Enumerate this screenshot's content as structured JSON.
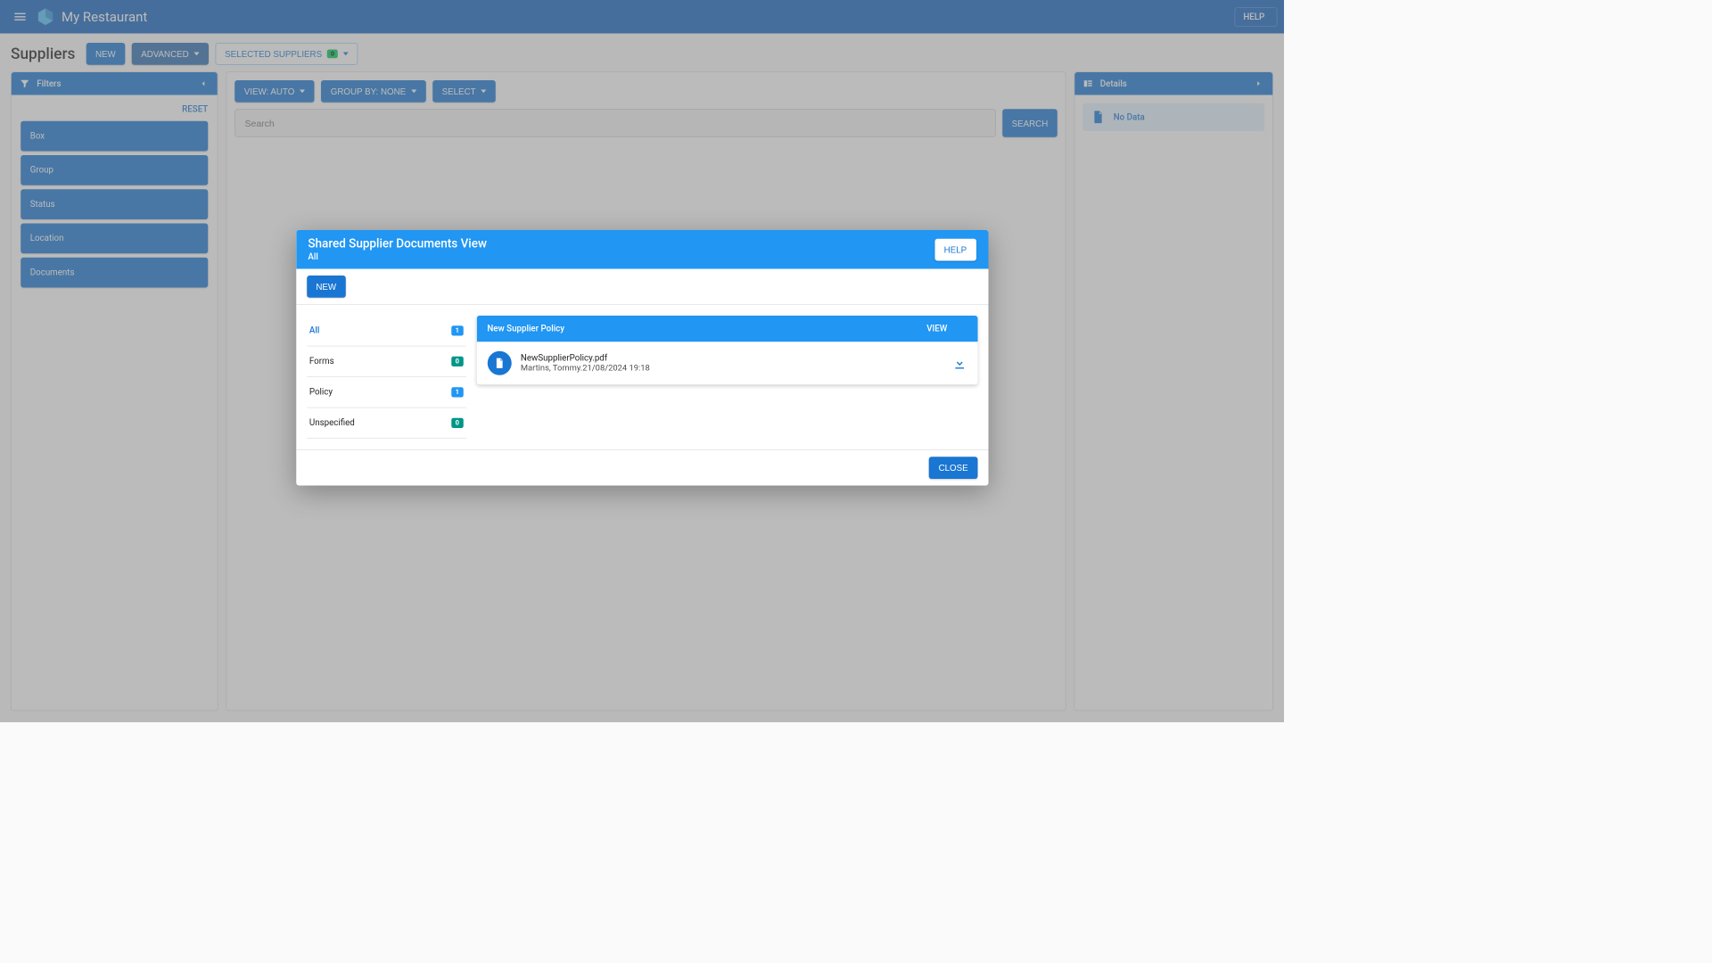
{
  "header": {
    "title": "My Restaurant",
    "help_label": "HELP"
  },
  "subheader": {
    "title": "Suppliers",
    "new_label": "NEW",
    "advanced_label": "ADVANCED",
    "selected_label": "SELECTED SUPPLIERS",
    "selected_count": "0"
  },
  "filters": {
    "title": "Filters",
    "reset_label": "RESET",
    "items": [
      {
        "label": "Box"
      },
      {
        "label": "Group"
      },
      {
        "label": "Status"
      },
      {
        "label": "Location"
      },
      {
        "label": "Documents"
      }
    ]
  },
  "toolbar": {
    "view_label": "VIEW: AUTO",
    "group_label": "GROUP BY: NONE",
    "select_label": "SELECT"
  },
  "search": {
    "placeholder": "Search",
    "button_label": "SEARCH"
  },
  "details": {
    "title": "Details",
    "no_data": "No Data"
  },
  "dialog": {
    "title": "Shared Supplier Documents View",
    "subtitle": "All",
    "help_label": "HELP",
    "new_label": "NEW",
    "close_label": "CLOSE",
    "categories": [
      {
        "label": "All",
        "count": "1",
        "pill": "blue",
        "active": true
      },
      {
        "label": "Forms",
        "count": "0",
        "pill": "green",
        "active": false
      },
      {
        "label": "Policy",
        "count": "1",
        "pill": "blue",
        "active": false
      },
      {
        "label": "Unspecified",
        "count": "0",
        "pill": "green",
        "active": false
      }
    ],
    "document": {
      "title": "New Supplier Policy",
      "view_label": "VIEW",
      "file_name": "NewSupplierPolicy.pdf",
      "file_meta": "Martins, Tommy.21/08/2024 19:18"
    }
  }
}
